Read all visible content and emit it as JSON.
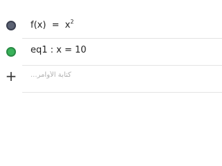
{
  "algebra": {
    "rows": [
      {
        "type": "function",
        "color": "#5b6273",
        "lhs": "f(x)",
        "eq": "=",
        "base": "x",
        "exponent": "2"
      },
      {
        "type": "equation",
        "color": "#39b25a",
        "text": "eq1 : x = 10"
      }
    ],
    "input": {
      "add_icon": "+",
      "placeholder": "كتابة الأوامر..."
    }
  }
}
